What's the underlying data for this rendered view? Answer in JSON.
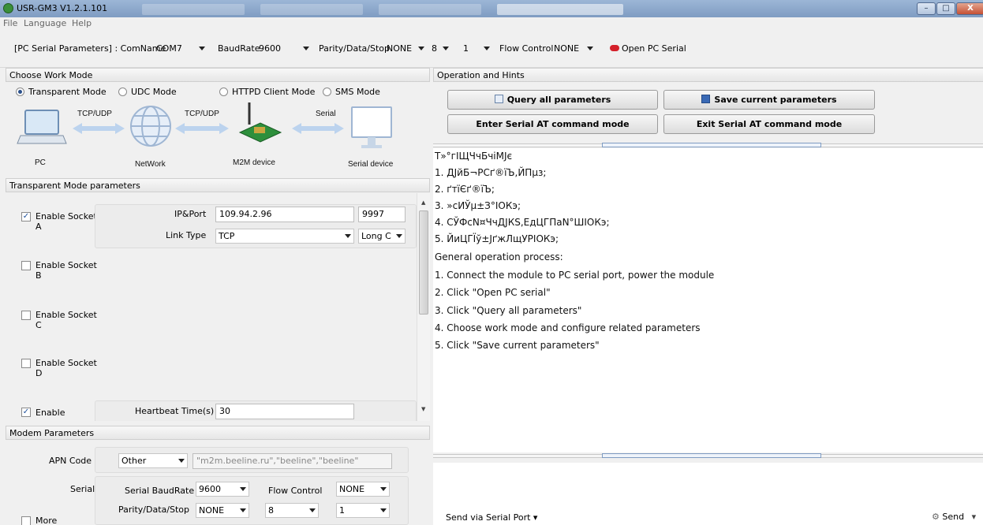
{
  "window": {
    "title": "USR-GM3 V1.2.1.101",
    "controls": [
      "minimize-icon",
      "maximize-icon",
      "close-icon"
    ]
  },
  "menu": [
    "File",
    "Language",
    "Help"
  ],
  "serial_bar": {
    "section_label": "[PC Serial Parameters] : ComName",
    "com_name": "COM7",
    "baud_label": "BaudRate",
    "baud_value": "9600",
    "parity_label": "Parity/Data/Stop",
    "parity_value": "NONE",
    "data_value": "8",
    "stop_value": "1",
    "flow_label": "Flow Control",
    "flow_value": "NONE",
    "open_label": "Open PC Serial"
  },
  "work_mode": {
    "header": "Choose Work Mode",
    "options": [
      "Transparent Mode",
      "UDC Mode",
      "HTTPD Client Mode",
      "SMS Mode"
    ],
    "selected": "Transparent Mode",
    "diagram": {
      "pc": "PC",
      "network": "NetWork",
      "m2m": "M2M device",
      "serial_device": "Serial device",
      "link1": "TCP/UDP",
      "link2": "TCP/UDP",
      "link3": "Serial"
    }
  },
  "transparent": {
    "header": "Transparent Mode parameters",
    "socket_a": {
      "label": "Enable Socket A",
      "checked": true,
      "ip_port_label": "IP&Port",
      "ip": "109.94.2.96",
      "port": "9997",
      "link_type_label": "Link Type",
      "link_type": "TCP",
      "conn_mode": "Long C"
    },
    "socket_b": {
      "label": "Enable Socket B",
      "checked": false
    },
    "socket_c": {
      "label": "Enable Socket C",
      "checked": false
    },
    "socket_d": {
      "label": "Enable Socket D",
      "checked": false
    },
    "heartbeat": {
      "label": "Enable",
      "checked": true,
      "time_label": "Heartbeat Time(s)",
      "time_value": "30"
    }
  },
  "modem": {
    "header": "Modem Parameters",
    "apn_label": "APN Code",
    "apn_select": "Other",
    "apn_value": "\"m2m.beeline.ru\",\"beeline\",\"beeline\"",
    "serial_label": "Serial",
    "baud_label": "Serial BaudRate",
    "baud_value": "9600",
    "flow_label": "Flow Control",
    "flow_value": "NONE",
    "parity_label": "Parity/Data/Stop",
    "parity_value": "NONE",
    "data_value": "8",
    "stop_value": "1",
    "more_label": "More"
  },
  "operations": {
    "header": "Operation and Hints",
    "query_button": "Query all parameters",
    "save_button": "Save current parameters",
    "enter_at_button": "Enter Serial AT command mode",
    "exit_at_button": "Exit Serial AT command mode"
  },
  "hints": [
    "Т»°гІЩЧчБчіМЈє",
    "1. ДЈйБ¬РСґ®їЪ,ЙПµз;",
    "2. ґтїЄґ®їЪ;",
    "3. »сИЎµ±З°ІОКэ;",
    "4. СЎФсN¤ЧчДЈКЅ,ЕдЦГПаN°ШІОКэ;",
    "5. ЙиЦГЇў±ЈґжЛщУРІОКэ;",
    "General operation process:",
    "1. Connect the module to PC serial port, power the module",
    "2. Click \"Open PC serial\"",
    "3. Click \"Query all parameters\"",
    "4. Choose work mode and configure related parameters",
    "5. Click \"Save current parameters\""
  ],
  "bottom": {
    "send_via": "Send via Serial Port",
    "send": "Send"
  }
}
